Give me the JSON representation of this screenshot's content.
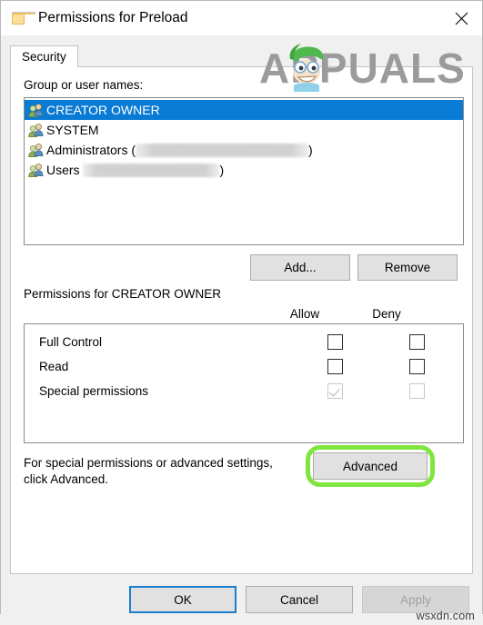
{
  "window": {
    "title": "Permissions for Preload",
    "folder_icon": "folder-icon",
    "close_icon": "close-icon"
  },
  "tabs": [
    {
      "label": "Security",
      "active": true
    }
  ],
  "group_section": {
    "label": "Group or user names:",
    "items": [
      {
        "name": "CREATOR OWNER",
        "selected": true,
        "redacted": false,
        "redact_width": 0,
        "suffix": ""
      },
      {
        "name": "SYSTEM",
        "selected": false,
        "redacted": false,
        "redact_width": 0,
        "suffix": ""
      },
      {
        "name": "Administrators (",
        "selected": false,
        "redacted": true,
        "redact_width": 190,
        "suffix": ")"
      },
      {
        "name": "Users ",
        "selected": false,
        "redacted": true,
        "redact_width": 150,
        "suffix": ")"
      }
    ]
  },
  "list_buttons": {
    "add": "Add...",
    "remove": "Remove"
  },
  "permissions_section": {
    "title": "Permissions for CREATOR OWNER",
    "columns": {
      "allow": "Allow",
      "deny": "Deny"
    },
    "rows": [
      {
        "name": "Full Control",
        "allow_checked": false,
        "deny_checked": false,
        "allow_disabled": false,
        "deny_disabled": false
      },
      {
        "name": "Read",
        "allow_checked": false,
        "deny_checked": false,
        "allow_disabled": false,
        "deny_disabled": false
      },
      {
        "name": "Special permissions",
        "allow_checked": true,
        "deny_checked": false,
        "allow_disabled": true,
        "deny_disabled": true
      }
    ]
  },
  "advanced_section": {
    "text": "For special permissions or advanced settings, click Advanced.",
    "button": "Advanced",
    "highlight_color": "#7ee63f"
  },
  "footer": {
    "ok": "OK",
    "cancel": "Cancel",
    "apply": "Apply",
    "apply_disabled": true,
    "focus_color": "#1a7fcc"
  },
  "watermarks": {
    "brand": "APPUALS",
    "site": "wsxdn.com"
  }
}
